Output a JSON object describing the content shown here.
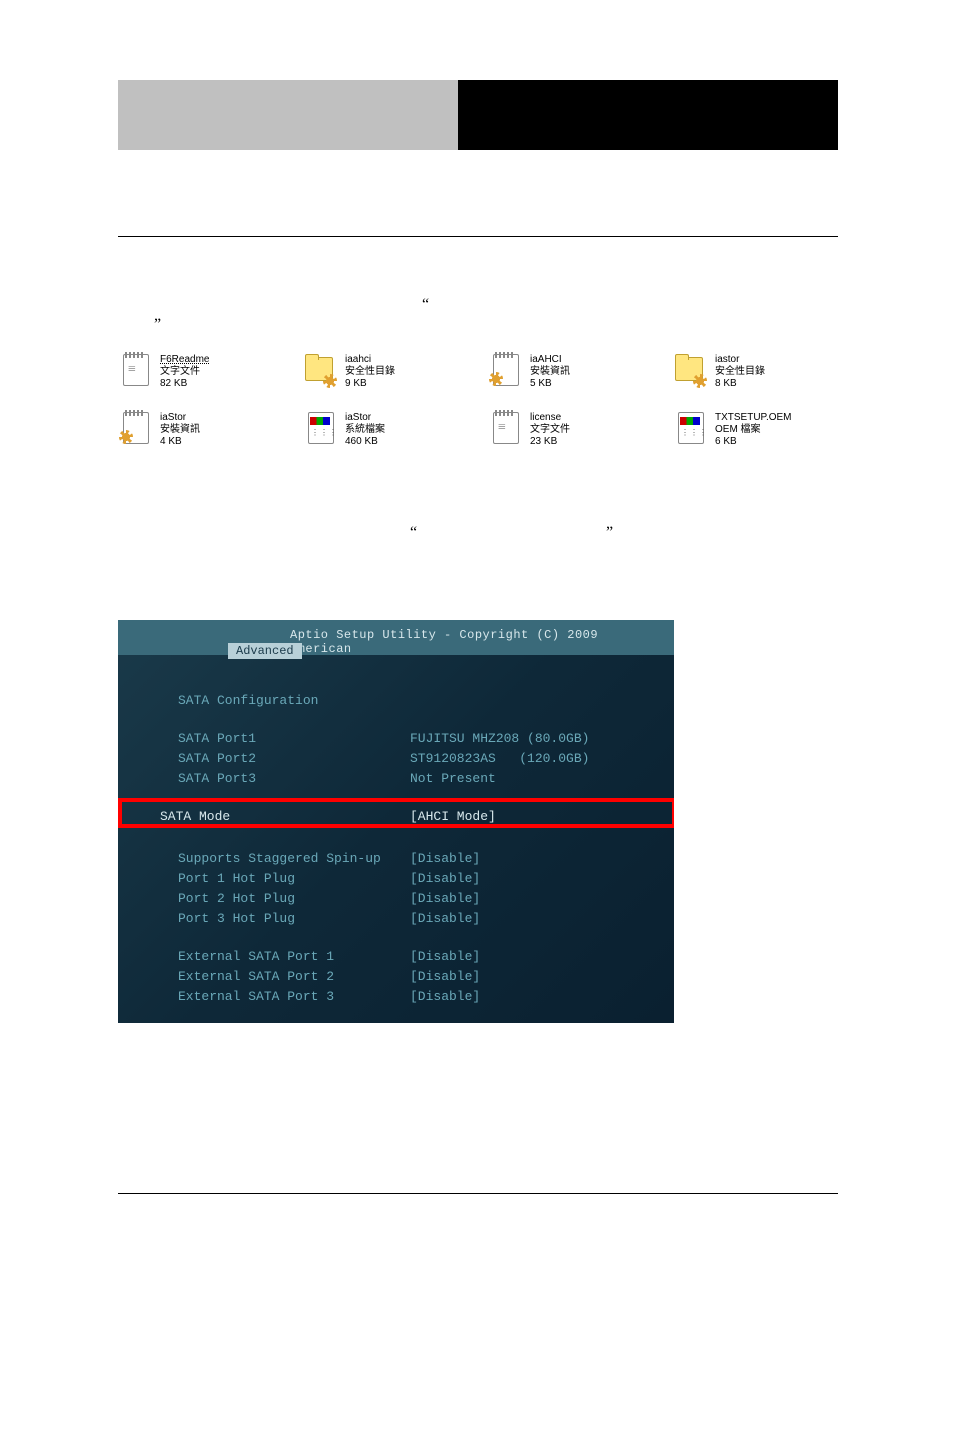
{
  "banner": {
    "bg_left": "#c0c0c0",
    "bg_right": "#000000"
  },
  "quotes": {
    "open": "“",
    "close": "”"
  },
  "files": {
    "row1": [
      {
        "name": "F6Readme",
        "type": "文字文件",
        "size": "82 KB",
        "icon": "text",
        "underline": true
      },
      {
        "name": "iaahci",
        "type": "安全性目錄",
        "size": "9 KB",
        "icon": "cat"
      },
      {
        "name": "iaAHCI",
        "type": "安裝資訊",
        "size": "5 KB",
        "icon": "inf"
      },
      {
        "name": "iastor",
        "type": "安全性目錄",
        "size": "8 KB",
        "icon": "cat"
      }
    ],
    "row2": [
      {
        "name": "iaStor",
        "type": "安裝資訊",
        "size": "4 KB",
        "icon": "inf"
      },
      {
        "name": "iaStor",
        "type": "系統檔案",
        "size": "460 KB",
        "icon": "sys"
      },
      {
        "name": "license",
        "type": "文字文件",
        "size": "23 KB",
        "icon": "text"
      },
      {
        "name": "TXTSETUP.OEM",
        "type": "OEM 檔案",
        "size": "6 KB",
        "icon": "sys"
      }
    ]
  },
  "bios": {
    "title": "Aptio Setup Utility - Copyright (C) 2009 American",
    "tab": "Advanced",
    "section": "SATA Configuration",
    "ports": [
      {
        "label": "SATA Port1",
        "value": "FUJITSU MHZ208 (80.0GB)"
      },
      {
        "label": "SATA Port2",
        "value": "ST9120823AS   (120.0GB)"
      },
      {
        "label": "SATA Port3",
        "value": "Not Present"
      }
    ],
    "highlight": {
      "label": "SATA Mode",
      "value": "[AHCI Mode]"
    },
    "options": [
      {
        "label": "Supports Staggered Spin-up",
        "value": "[Disable]"
      },
      {
        "label": "Port 1 Hot Plug",
        "value": "[Disable]"
      },
      {
        "label": "Port 2 Hot Plug",
        "value": "[Disable]"
      },
      {
        "label": "Port 3 Hot Plug",
        "value": "[Disable]"
      }
    ],
    "external": [
      {
        "label": "External SATA Port 1",
        "value": "[Disable]"
      },
      {
        "label": "External SATA Port 2",
        "value": "[Disable]"
      },
      {
        "label": "External SATA Port 3",
        "value": "[Disable]"
      }
    ]
  }
}
